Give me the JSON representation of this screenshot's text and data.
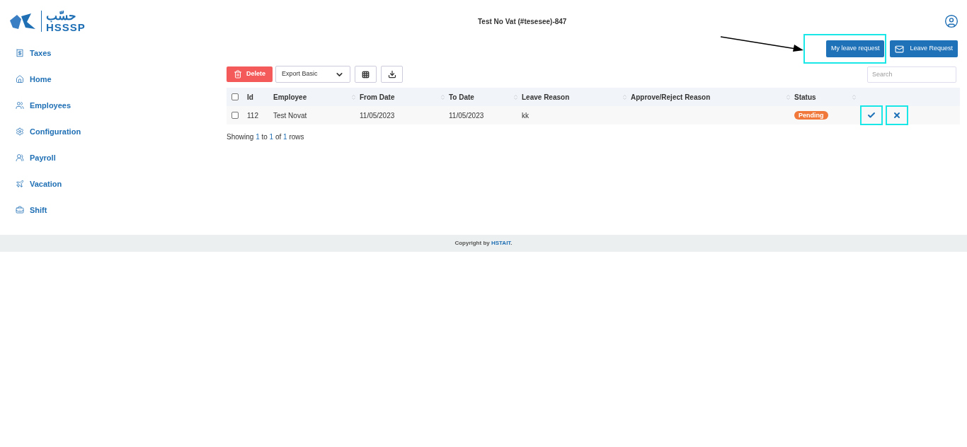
{
  "logo": {
    "arabic": "حسّب",
    "latin": "HSSSP"
  },
  "header": {
    "title": "Test No Vat (#tesesee)-847"
  },
  "sidebar": {
    "items": [
      {
        "label": "Taxes",
        "kind": "receipt"
      },
      {
        "label": "Home",
        "kind": "home"
      },
      {
        "label": "Employees",
        "kind": "people"
      },
      {
        "label": "Configuration",
        "kind": "gear"
      },
      {
        "label": "Payroll",
        "kind": "payroll"
      },
      {
        "label": "Vacation",
        "kind": "vacation"
      },
      {
        "label": "Shift",
        "kind": "shift"
      }
    ]
  },
  "actions": {
    "annotation_arrow": true,
    "buttons": [
      {
        "label": "My leave request",
        "kind": "plain",
        "highlighted": true
      },
      {
        "label": "Leave Request",
        "kind": "mail",
        "highlighted": false
      }
    ]
  },
  "toolbar": {
    "delete": "Delete",
    "export": "Export Basic",
    "search": {
      "placeholder": "Search"
    }
  },
  "table": {
    "select_all": {
      "checked": false
    },
    "columns": [
      "Id",
      "Employee",
      "From Date",
      "To Date",
      "Leave Reason",
      "Approve/Reject Reason",
      "Status"
    ],
    "rows": [
      {
        "checked": false,
        "cells": [
          "112",
          "Test Novat",
          "11/05/2023",
          "11/05/2023",
          "kk",
          ""
        ],
        "status": {
          "label": "Pending",
          "color": "#f0783a"
        },
        "actions": [
          {
            "kind": "approve",
            "highlighted": true
          },
          {
            "kind": "reject",
            "highlighted": true
          }
        ]
      }
    ]
  },
  "summary": {
    "prefix": "Showing ",
    "from": "1",
    "mid1": " to ",
    "to": "1",
    "mid2": " of ",
    "total": "1",
    "suffix": " rows"
  },
  "footer": {
    "prefix": "Copyright by ",
    "link": "HSTAIT",
    "suffix": "."
  }
}
